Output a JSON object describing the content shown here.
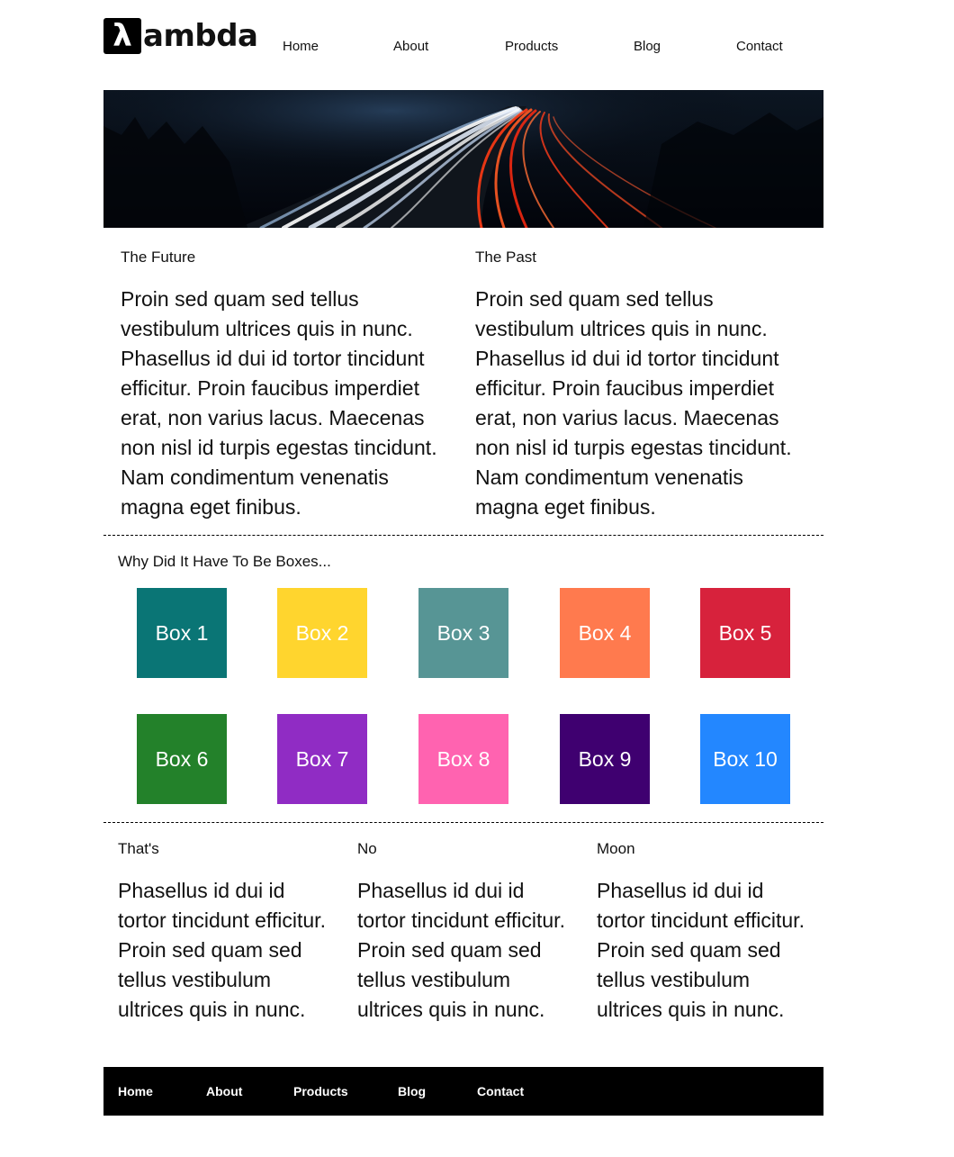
{
  "logo": {
    "mark": "λ",
    "text": "ambda"
  },
  "nav": [
    "Home",
    "About",
    "Products",
    "Blog",
    "Contact"
  ],
  "hero": {
    "alt": "Light trails on highway at night"
  },
  "sections": [
    {
      "title": "The Future",
      "body": "Proin sed quam sed tellus vestibulum ultrices quis in nunc. Phasellus id dui id tortor tincidunt efficitur. Proin faucibus imperdiet erat, non varius lacus. Maecenas non nisl id turpis egestas tincidunt. Nam condimentum venenatis magna eget finibus."
    },
    {
      "title": "The Past",
      "body": "Proin sed quam sed tellus vestibulum ultrices quis in nunc. Phasellus id dui id tortor tincidunt efficitur. Proin faucibus imperdiet erat, non varius lacus. Maecenas non nisl id turpis egestas tincidunt. Nam condimentum venenatis magna eget finibus."
    }
  ],
  "boxes_title": "Why Did It Have To Be Boxes...",
  "boxes": [
    {
      "label": "Box 1",
      "color": "#0a7575"
    },
    {
      "label": "Box 2",
      "color": "#ffd52e"
    },
    {
      "label": "Box 3",
      "color": "#579595"
    },
    {
      "label": "Box 4",
      "color": "#ff7a4e"
    },
    {
      "label": "Box 5",
      "color": "#d7223c"
    },
    {
      "label": "Box 6",
      "color": "#23812a"
    },
    {
      "label": "Box 7",
      "color": "#902cc4"
    },
    {
      "label": "Box 8",
      "color": "#ff63b0"
    },
    {
      "label": "Box 9",
      "color": "#3f0070"
    },
    {
      "label": "Box 10",
      "color": "#2387ff"
    }
  ],
  "columns": [
    {
      "title": "That's",
      "body": "Phasellus id dui id tortor tincidunt efficitur. Proin sed quam sed tellus vestibulum ultrices quis in nunc."
    },
    {
      "title": "No",
      "body": "Phasellus id dui id tortor tincidunt efficitur. Proin sed quam sed tellus vestibulum ultrices quis in nunc."
    },
    {
      "title": "Moon",
      "body": "Phasellus id dui id tortor tincidunt efficitur. Proin sed quam sed tellus vestibulum ultrices quis in nunc."
    }
  ],
  "footer_nav": [
    "Home",
    "About",
    "Products",
    "Blog",
    "Contact"
  ]
}
